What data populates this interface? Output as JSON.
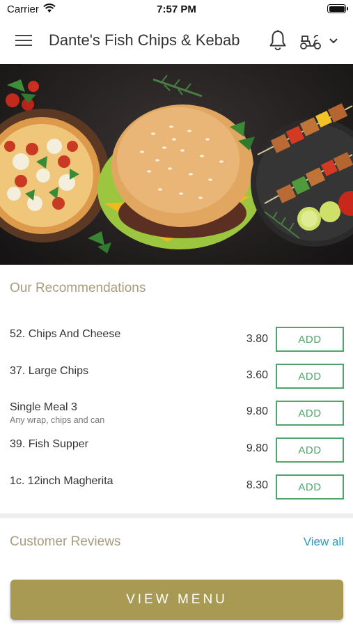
{
  "status_bar": {
    "carrier": "Carrier",
    "time": "7:57 PM"
  },
  "header": {
    "title": "Dante's Fish Chips & Kebab",
    "icons": [
      "menu-icon",
      "bell-icon",
      "scooter-icon",
      "chevron-down-icon"
    ]
  },
  "recommendations": {
    "title": "Our Recommendations",
    "add_label": "ADD",
    "items": [
      {
        "name": "52. Chips And Cheese",
        "description": "",
        "price": "3.80"
      },
      {
        "name": "37. Large Chips",
        "description": "",
        "price": "3.60"
      },
      {
        "name": "Single Meal 3",
        "description": "Any wrap, chips and can",
        "price": "9.80"
      },
      {
        "name": "39. Fish Supper",
        "description": "",
        "price": "9.80"
      },
      {
        "name": "1c. 12inch Magherita",
        "description": "",
        "price": "8.30"
      }
    ]
  },
  "reviews": {
    "title": "Customer Reviews",
    "view_all": "View all"
  },
  "footer": {
    "view_menu": "VIEW MENU"
  },
  "colors": {
    "accent_gold": "#a99a53",
    "section_title": "#a99c7c",
    "add_green": "#4ea46a",
    "link_blue": "#2e9ab8"
  }
}
